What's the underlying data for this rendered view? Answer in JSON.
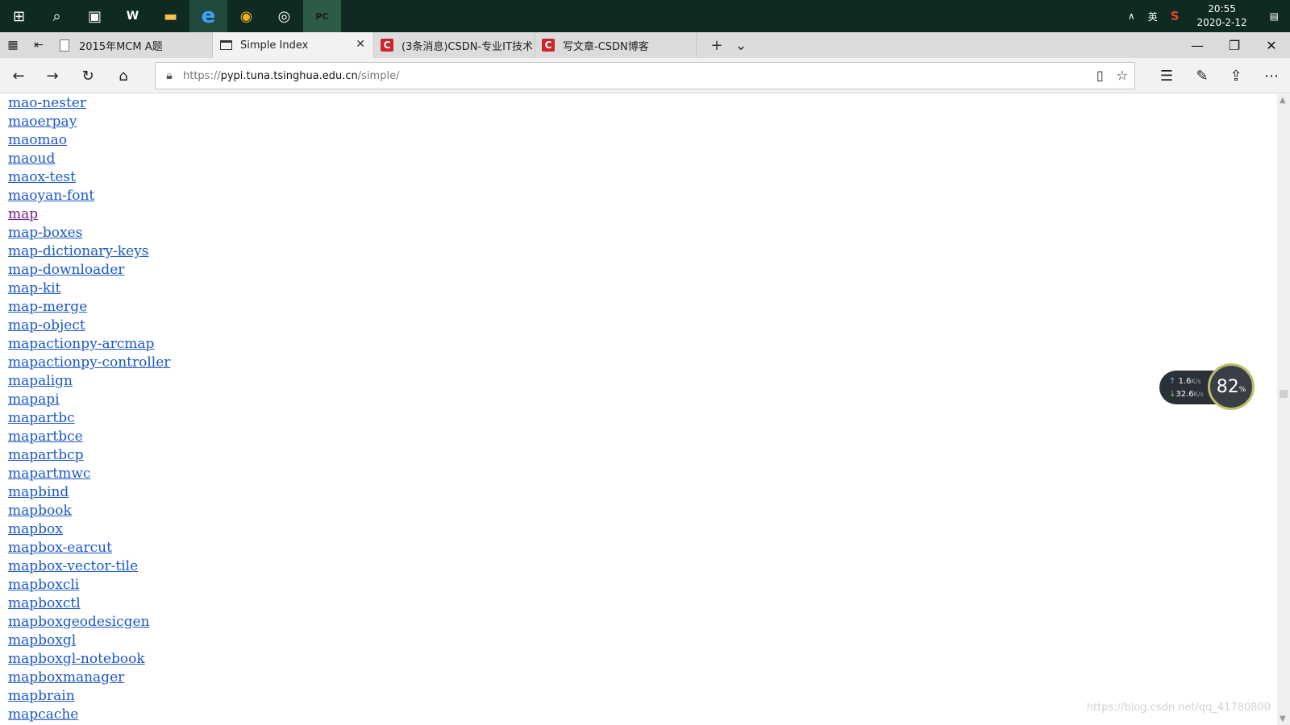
{
  "taskbar": {
    "apps": [
      {
        "icon": "windows-start-icon",
        "glyph": "⊞"
      },
      {
        "icon": "search-icon",
        "glyph": "⌕"
      },
      {
        "icon": "task-view-icon",
        "glyph": "▣"
      },
      {
        "icon": "word-icon",
        "glyph": "W"
      },
      {
        "icon": "file-explorer-icon",
        "glyph": "▬"
      },
      {
        "icon": "edge-icon",
        "glyph": "e"
      },
      {
        "icon": "chrome-icon",
        "glyph": "◉"
      },
      {
        "icon": "app-icon",
        "glyph": "◎"
      },
      {
        "icon": "pycharm-icon",
        "glyph": "PC"
      }
    ],
    "tray_ime": "英",
    "tray_sogou": "S",
    "time": "20:55",
    "date": "2020-2-12"
  },
  "tabs": [
    {
      "title": "2015年MCM A题",
      "favicon": "doc",
      "active": false
    },
    {
      "title": "Simple Index",
      "favicon": "page",
      "active": true
    },
    {
      "title": "(3条消息)CSDN-专业IT技术",
      "favicon": "csdn",
      "active": false
    },
    {
      "title": "写文章-CSDN博客",
      "favicon": "csdn",
      "active": false
    }
  ],
  "address": {
    "url_scheme": "https://",
    "url_host": "pypi.tuna.tsinghua.edu.cn",
    "url_path": "/simple/"
  },
  "links": [
    "mao-nester",
    "maoerpay",
    "maomao",
    "maoud",
    "maox-test",
    "maoyan-font",
    "map",
    "map-boxes",
    "map-dictionary-keys",
    "map-downloader",
    "map-kit",
    "map-merge",
    "map-object",
    "mapactionpy-arcmap",
    "mapactionpy-controller",
    "mapalign",
    "mapapi",
    "mapartbc",
    "mapartbce",
    "mapartbcp",
    "mapartmwc",
    "mapbind",
    "mapbook",
    "mapbox",
    "mapbox-earcut",
    "mapbox-vector-tile",
    "mapboxcli",
    "mapboxctl",
    "mapboxgeodesicgen",
    "mapboxgl",
    "mapboxgl-notebook",
    "mapboxmanager",
    "mapbrain",
    "mapcache"
  ],
  "visited_link": "map",
  "netmon": {
    "upload": "1.6",
    "download": "32.6",
    "unit": "K/s",
    "percent": "82",
    "percent_sign": "%"
  },
  "watermark": "https://blog.csdn.net/qq_41780800",
  "colors": {
    "taskbar": "#0f2a22",
    "link": "#1a57c7",
    "visited_link": "#7a1d8f"
  }
}
